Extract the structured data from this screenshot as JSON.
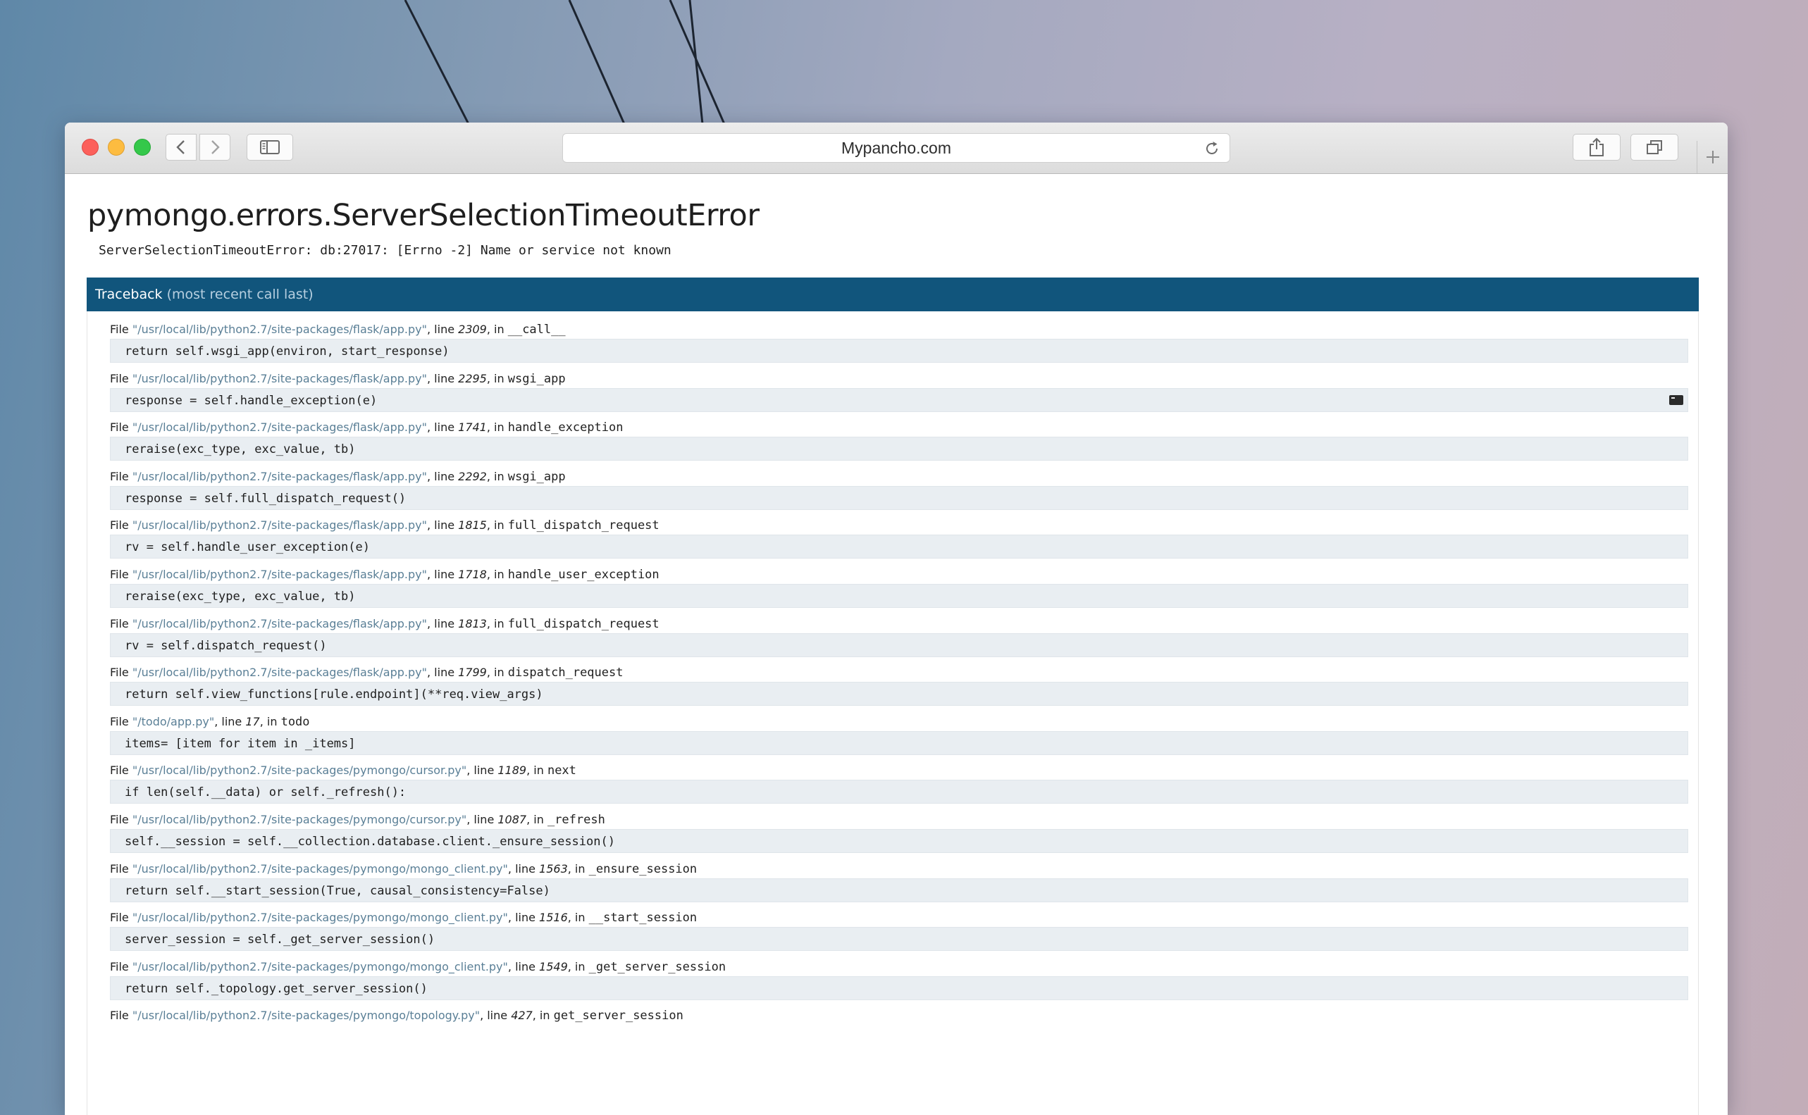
{
  "window": {
    "url": "Mypancho.com"
  },
  "page": {
    "title": "pymongo.errors.ServerSelectionTimeoutError",
    "message": "ServerSelectionTimeoutError: db:27017: [Errno -2] Name or service not known"
  },
  "traceback": {
    "heading": "Traceback",
    "subheading": "(most recent call last)",
    "frames": [
      {
        "path": "\"/usr/local/lib/python2.7/site-packages/flask/app.py\"",
        "line": "2309",
        "func": "__call__",
        "code": "return self.wsgi_app(environ, start_response)"
      },
      {
        "path": "\"/usr/local/lib/python2.7/site-packages/flask/app.py\"",
        "line": "2295",
        "func": "wsgi_app",
        "code": "response = self.handle_exception(e)"
      },
      {
        "path": "\"/usr/local/lib/python2.7/site-packages/flask/app.py\"",
        "line": "1741",
        "func": "handle_exception",
        "code": "reraise(exc_type, exc_value, tb)"
      },
      {
        "path": "\"/usr/local/lib/python2.7/site-packages/flask/app.py\"",
        "line": "2292",
        "func": "wsgi_app",
        "code": "response = self.full_dispatch_request()"
      },
      {
        "path": "\"/usr/local/lib/python2.7/site-packages/flask/app.py\"",
        "line": "1815",
        "func": "full_dispatch_request",
        "code": "rv = self.handle_user_exception(e)"
      },
      {
        "path": "\"/usr/local/lib/python2.7/site-packages/flask/app.py\"",
        "line": "1718",
        "func": "handle_user_exception",
        "code": "reraise(exc_type, exc_value, tb)"
      },
      {
        "path": "\"/usr/local/lib/python2.7/site-packages/flask/app.py\"",
        "line": "1813",
        "func": "full_dispatch_request",
        "code": "rv = self.dispatch_request()"
      },
      {
        "path": "\"/usr/local/lib/python2.7/site-packages/flask/app.py\"",
        "line": "1799",
        "func": "dispatch_request",
        "code": "return self.view_functions[rule.endpoint](**req.view_args)"
      },
      {
        "path": "\"/todo/app.py\"",
        "line": "17",
        "func": "todo",
        "code": "items= [item for item in _items]"
      },
      {
        "path": "\"/usr/local/lib/python2.7/site-packages/pymongo/cursor.py\"",
        "line": "1189",
        "func": "next",
        "code": "if len(self.__data) or self._refresh():"
      },
      {
        "path": "\"/usr/local/lib/python2.7/site-packages/pymongo/cursor.py\"",
        "line": "1087",
        "func": "_refresh",
        "code": "self.__session = self.__collection.database.client._ensure_session()"
      },
      {
        "path": "\"/usr/local/lib/python2.7/site-packages/pymongo/mongo_client.py\"",
        "line": "1563",
        "func": "_ensure_session",
        "code": "return self.__start_session(True, causal_consistency=False)"
      },
      {
        "path": "\"/usr/local/lib/python2.7/site-packages/pymongo/mongo_client.py\"",
        "line": "1516",
        "func": "__start_session",
        "code": "server_session = self._get_server_session()"
      },
      {
        "path": "\"/usr/local/lib/python2.7/site-packages/pymongo/mongo_client.py\"",
        "line": "1549",
        "func": "_get_server_session",
        "code": "return self._topology.get_server_session()"
      },
      {
        "path": "\"/usr/local/lib/python2.7/site-packages/pymongo/topology.py\"",
        "line": "427",
        "func": "get_server_session",
        "code": ""
      }
    ],
    "label_file": "File",
    "label_line": ", line",
    "label_in": ", in"
  },
  "icons": {
    "back": "chevron-left-icon",
    "forward": "chevron-right-icon",
    "sidebar": "sidebar-icon",
    "reload": "reload-icon",
    "share": "share-icon",
    "tabs": "tabs-icon",
    "new_tab": "plus-icon",
    "console": "console-icon"
  }
}
